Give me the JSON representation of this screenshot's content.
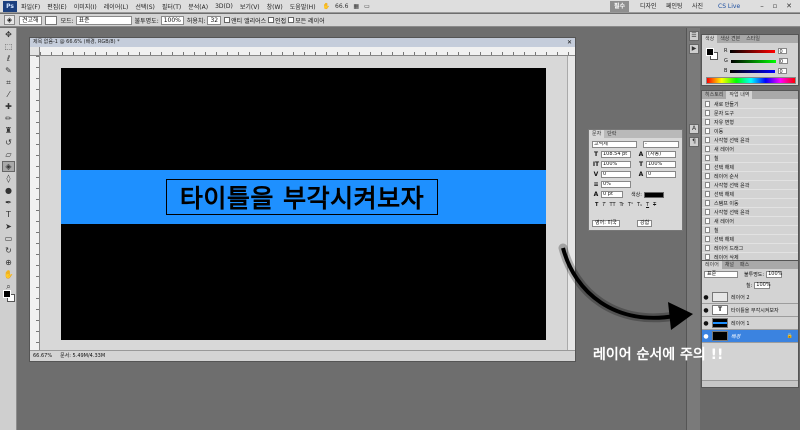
{
  "menubar": {
    "app_icon": "Ps",
    "items": [
      "파일(F)",
      "편집(E)",
      "이미지(I)",
      "레이어(L)",
      "선택(S)",
      "필터(T)",
      "분석(A)",
      "3D(D)",
      "보기(V)",
      "창(W)",
      "도움말(H)"
    ],
    "zoom": "66.6",
    "workspaces": [
      "필수",
      "디자인",
      "페인팅",
      "사진"
    ],
    "active_workspace": "필수",
    "cs_live": "CS Live"
  },
  "options": {
    "style_label": "견고해",
    "mode_label": "모드:",
    "mode_value": "표준",
    "opacity_label": "불투명도:",
    "opacity_value": "100%",
    "tolerance_label": "허용치:",
    "tolerance_value": "32",
    "antialias_label": "앤티 앨리어스",
    "contiguous_label": "인접",
    "all_layers_label": "모든 레이어"
  },
  "document": {
    "title": "제목 없음-1 @ 66.6% (배경, RGB/8) *",
    "zoom_status": "66.67%",
    "doc_status": "문서: 5.49M/4.33M"
  },
  "canvas": {
    "band_color": "#1e90ff",
    "title_text": "타이틀을 부각시켜보자"
  },
  "character_panel": {
    "tabs": [
      "문자",
      "단락"
    ],
    "font_family": "고딕체",
    "font_style": "-",
    "font_size": "108.54 pt",
    "leading": "(자동)",
    "vertical_scale": "100%",
    "horizontal_scale": "100%",
    "tracking": "0",
    "kerning": "0",
    "tsume": "0%",
    "baseline": "0 pt",
    "color_label": "색상:",
    "styles": [
      "T",
      "T",
      "TT",
      "Tr",
      "T¹",
      "T₁",
      "T",
      "T"
    ],
    "language": "영어: 미국",
    "antialias": "강함"
  },
  "color_panel": {
    "tabs": [
      "색상",
      "색상 견본",
      "스타일"
    ],
    "channels": [
      "R",
      "G",
      "B"
    ],
    "values": [
      "0",
      "0",
      "0"
    ]
  },
  "history_panel": {
    "tabs": [
      "히스토리",
      "작업 내역"
    ],
    "items": [
      "새로 만들기",
      "문자 도구",
      "자유 변형",
      "이동",
      "사각형 선택 윤곽",
      "새 레이어",
      "칠",
      "선택 해제",
      "레이어 순서",
      "사각형 선택 윤곽",
      "선택 해제",
      "스탬프 이동",
      "사각형 선택 윤곽",
      "새 레이어",
      "칠",
      "선택 해제",
      "레이어 드래그",
      "레이어 삭제",
      "배경으로 칠"
    ],
    "active_index": 18
  },
  "layers_panel": {
    "tabs": [
      "레이어",
      "채널",
      "패스"
    ],
    "blend_mode": "표준",
    "opacity_label": "불투명도:",
    "opacity_value": "100%",
    "fill_label": "칠:",
    "fill_value": "100%",
    "layers": [
      {
        "name": "레이어 2"
      },
      {
        "name": "타이틀을 부각시켜보자",
        "thumb": "T"
      },
      {
        "name": "레이어 1"
      },
      {
        "name": "배경"
      }
    ],
    "active_layer": "배경"
  },
  "annotation": {
    "text": "레이어 순서에 주의 !!"
  }
}
